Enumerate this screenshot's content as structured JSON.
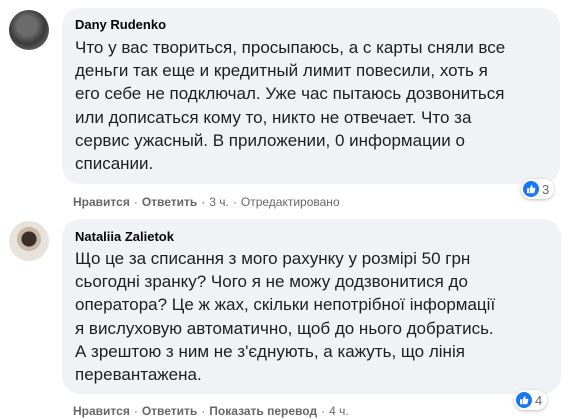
{
  "comments": [
    {
      "author": "Dany Rudenko",
      "text": "Что у вас твориться, просыпаюсь, а с карты сняли все\nденьги так еще и кредитный лимит повесили, хоть я\nего себе не подключал. Уже час пытаюсь дозвониться\nили дописаться кому то, никто не отвечает. Что за\nсервис ужасный. В приложении, 0 информации о\nсписании.",
      "reaction_count": "3",
      "actions": {
        "like": "Нравится",
        "reply": "Ответить",
        "time": "3 ч.",
        "edited": "Отредактировано"
      }
    },
    {
      "author": "Nataliia Zalietok",
      "text": "Що це за списання з мого рахунку у розмірі 50 грн\nсьогодні зранку? Чого я не можу додзвонитися до\nоператора? Це ж жах, скільки непотрібної інформації\nя вислуховую автоматично, щоб до нього добратись.\nА зрештою з ним не з'єднують, а кажуть, що лінія\nперевантажена.",
      "reaction_count": "4",
      "actions": {
        "like": "Нравится",
        "reply": "Ответить",
        "translate": "Показать перевод",
        "time": "4 ч."
      }
    }
  ],
  "icons": {
    "reaction": "thumbs-up-icon",
    "accent": "#1877f2"
  }
}
